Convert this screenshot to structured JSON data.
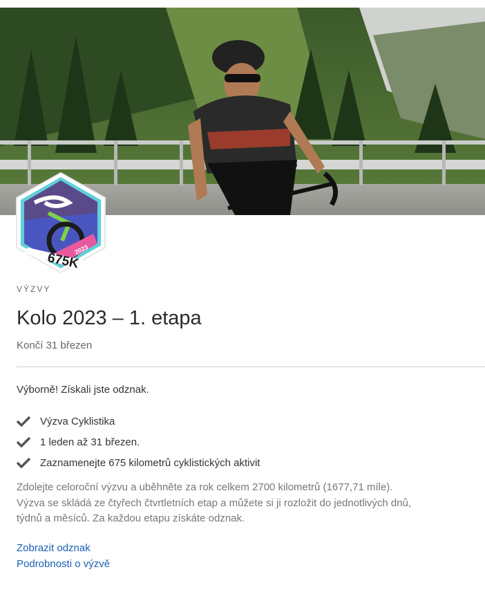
{
  "hero": {
    "alt": "cyclist on mountain road"
  },
  "badge": {
    "distance": "675K",
    "year": "2023"
  },
  "header": {
    "eyebrow": "VÝZVY",
    "title": "Kolo 2023 – 1. etapa",
    "subtitle": "Končí 31 březen"
  },
  "status": {
    "message": "Výborně! Získali jste odznak."
  },
  "requirements": [
    {
      "label": "Výzva Cyklistika",
      "icon": "check-icon"
    },
    {
      "label": "1 leden až 31 březen.",
      "icon": "check-icon"
    },
    {
      "label": "Zaznamenejte 675 kilometrů cyklistických aktivit",
      "icon": "check-icon"
    }
  ],
  "description": "Zdolejte celoroční výzvu a uběhněte za rok celkem 2700 kilometrů (1677,71 míle). Výzva se skládá ze čtyřech čtvrtletních etap a můžete si ji rozložit do jednotlivých dnů, týdnů a měsíců. Za každou etapu získáte odznak.",
  "links": {
    "show_badge": "Zobrazit odznak",
    "details": "Podrobnosti o výzvě"
  },
  "colors": {
    "link": "#1a5fb4",
    "badge_hex_border": "#5fd0d8",
    "badge_purple": "#5a4a8a",
    "badge_pink": "#e85aa0"
  }
}
